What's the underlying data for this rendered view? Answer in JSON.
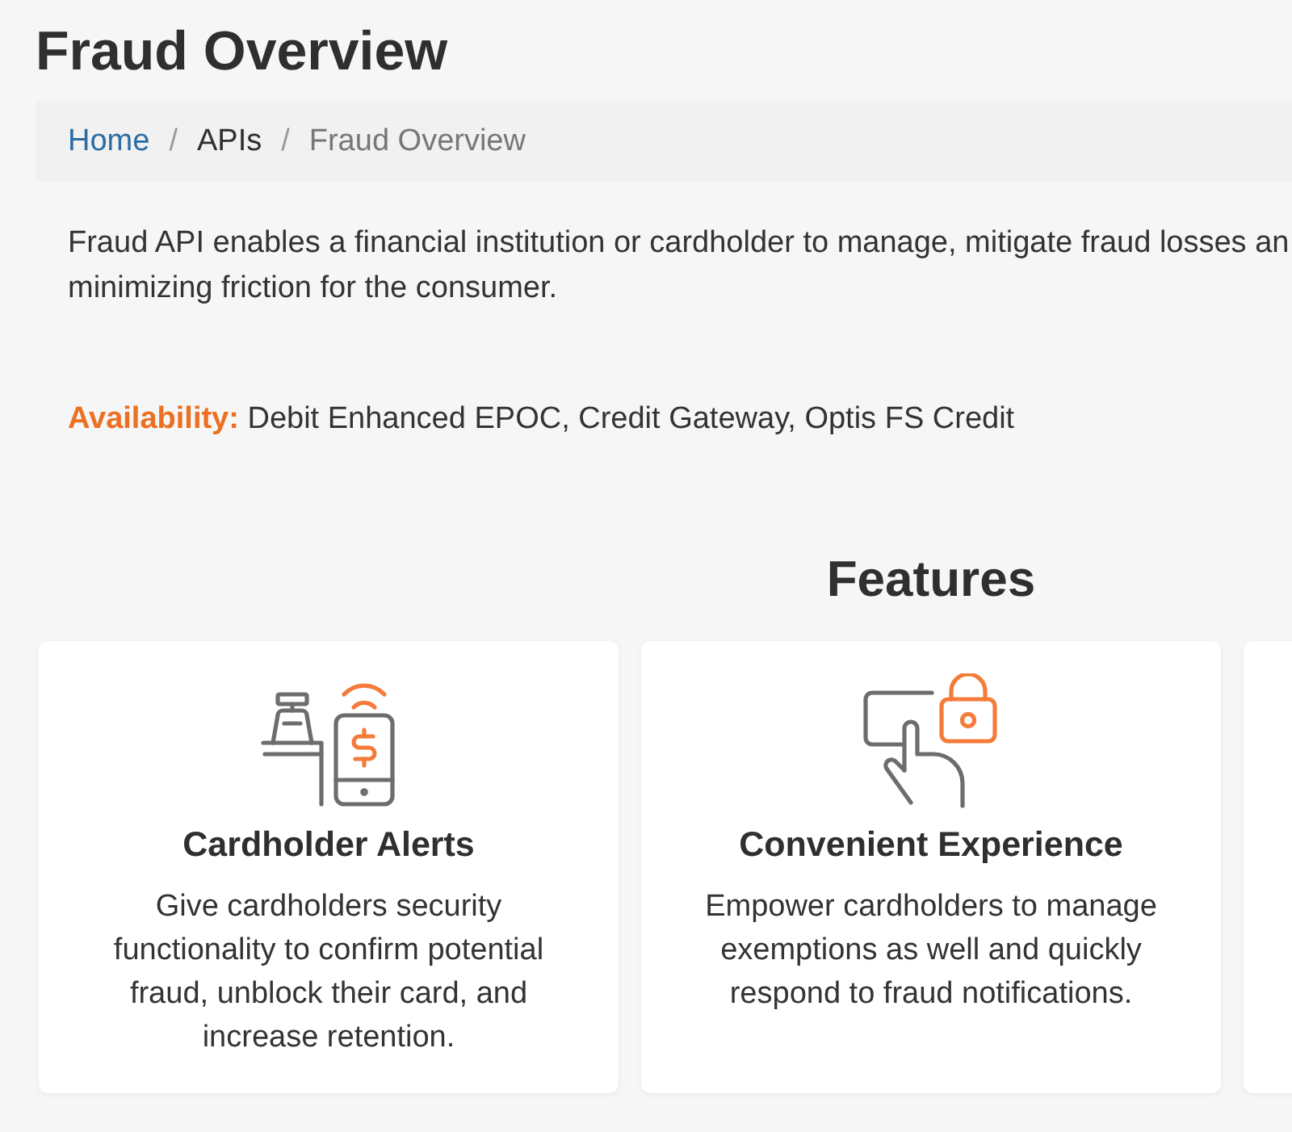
{
  "page": {
    "title": "Fraud Overview"
  },
  "breadcrumb": {
    "items": [
      {
        "label": "Home",
        "kind": "link"
      },
      {
        "label": "APIs",
        "kind": "text"
      },
      {
        "label": "Fraud Overview",
        "kind": "current"
      }
    ],
    "separators": [
      "/",
      "/"
    ]
  },
  "description": {
    "lines": [
      "Fraud API enables a financial institution or cardholder to manage, mitigate fraud losses an",
      "minimizing friction for the consumer."
    ]
  },
  "availability": {
    "label": "Availability:",
    "value": "Debit Enhanced EPOC, Credit Gateway, Optis FS Credit"
  },
  "features": {
    "title": "Features",
    "cards": [
      {
        "title": "Cardholder Alerts",
        "text": "Give cardholders security functionality to confirm potential fraud, unblock their card, and increase retention."
      },
      {
        "title": "Convenient Experience",
        "text": "Empower cardholders to manage exemptions as well and quickly respond to fraud notifications."
      }
    ]
  }
}
